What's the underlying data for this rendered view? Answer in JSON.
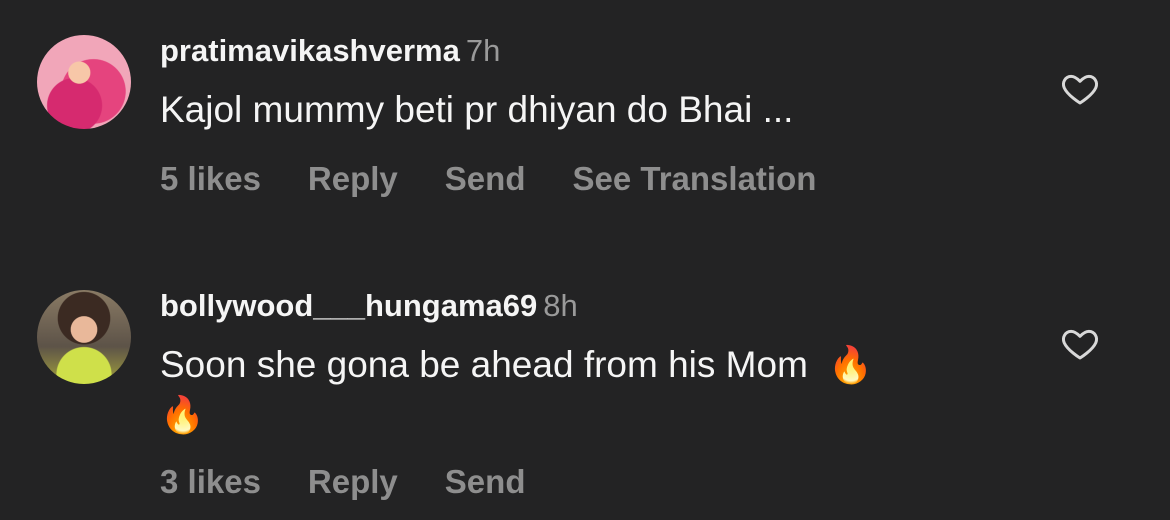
{
  "comments": [
    {
      "username": "pratimavikashverma",
      "time": "7h",
      "text": "Kajol mummy beti pr dhiyan do Bhai ...",
      "emoji_line1": "",
      "emoji_line2": "",
      "likes": "5 likes",
      "reply": "Reply",
      "send": "Send",
      "translation": "See Translation",
      "avatar_icon": "avatar-pink-hands"
    },
    {
      "username": "bollywood___hungama69",
      "time": "8h",
      "text": "Soon she gona be ahead from his Mom",
      "emoji_line1": "🔥",
      "emoji_line2": "🔥",
      "likes": "3 likes",
      "reply": "Reply",
      "send": "Send",
      "avatar_icon": "avatar-woman-portrait"
    }
  ],
  "colors": {
    "background": "#232324",
    "primary_text": "#f5f5f5",
    "secondary_text": "#8e8e8e"
  }
}
